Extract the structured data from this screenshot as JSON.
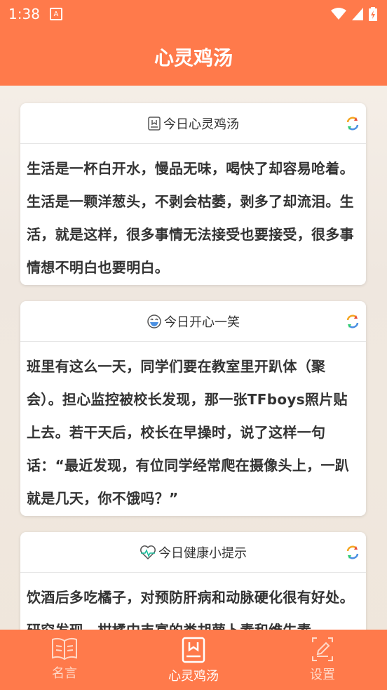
{
  "status": {
    "time": "1:38"
  },
  "header": {
    "title": "心灵鸡汤"
  },
  "cards": [
    {
      "title": "今日心灵鸡汤",
      "body": "生活是一杯白开水，慢品无味，喝快了却容易呛着。生活是一颗洋葱头，不剥会枯萎，剥多了却流泪。生活，就是这样，很多事情无法接受也要接受，很多事情想不明白也要明白。"
    },
    {
      "title": "今日开心一笑",
      "body": "班里有这么一天，同学们要在教室里开趴体（聚会）。担心监控被校长发现，那一张TFboys照片贴上去。若干天后，校长在早操时，说了这样一句话：“最近发现，有位同学经常爬在摄像头上，一趴就是几天，你不饿吗？”"
    },
    {
      "title": "今日健康小提示",
      "body": "饮酒后多吃橘子，对预防肝病和动脉硬化很有好处。研究发现，柑橘中丰富的类胡萝卜素和维生素"
    }
  ],
  "nav": [
    {
      "label": "名言"
    },
    {
      "label": "心灵鸡汤"
    },
    {
      "label": "设置"
    }
  ],
  "colors": {
    "primary": "#ff7a4b"
  }
}
